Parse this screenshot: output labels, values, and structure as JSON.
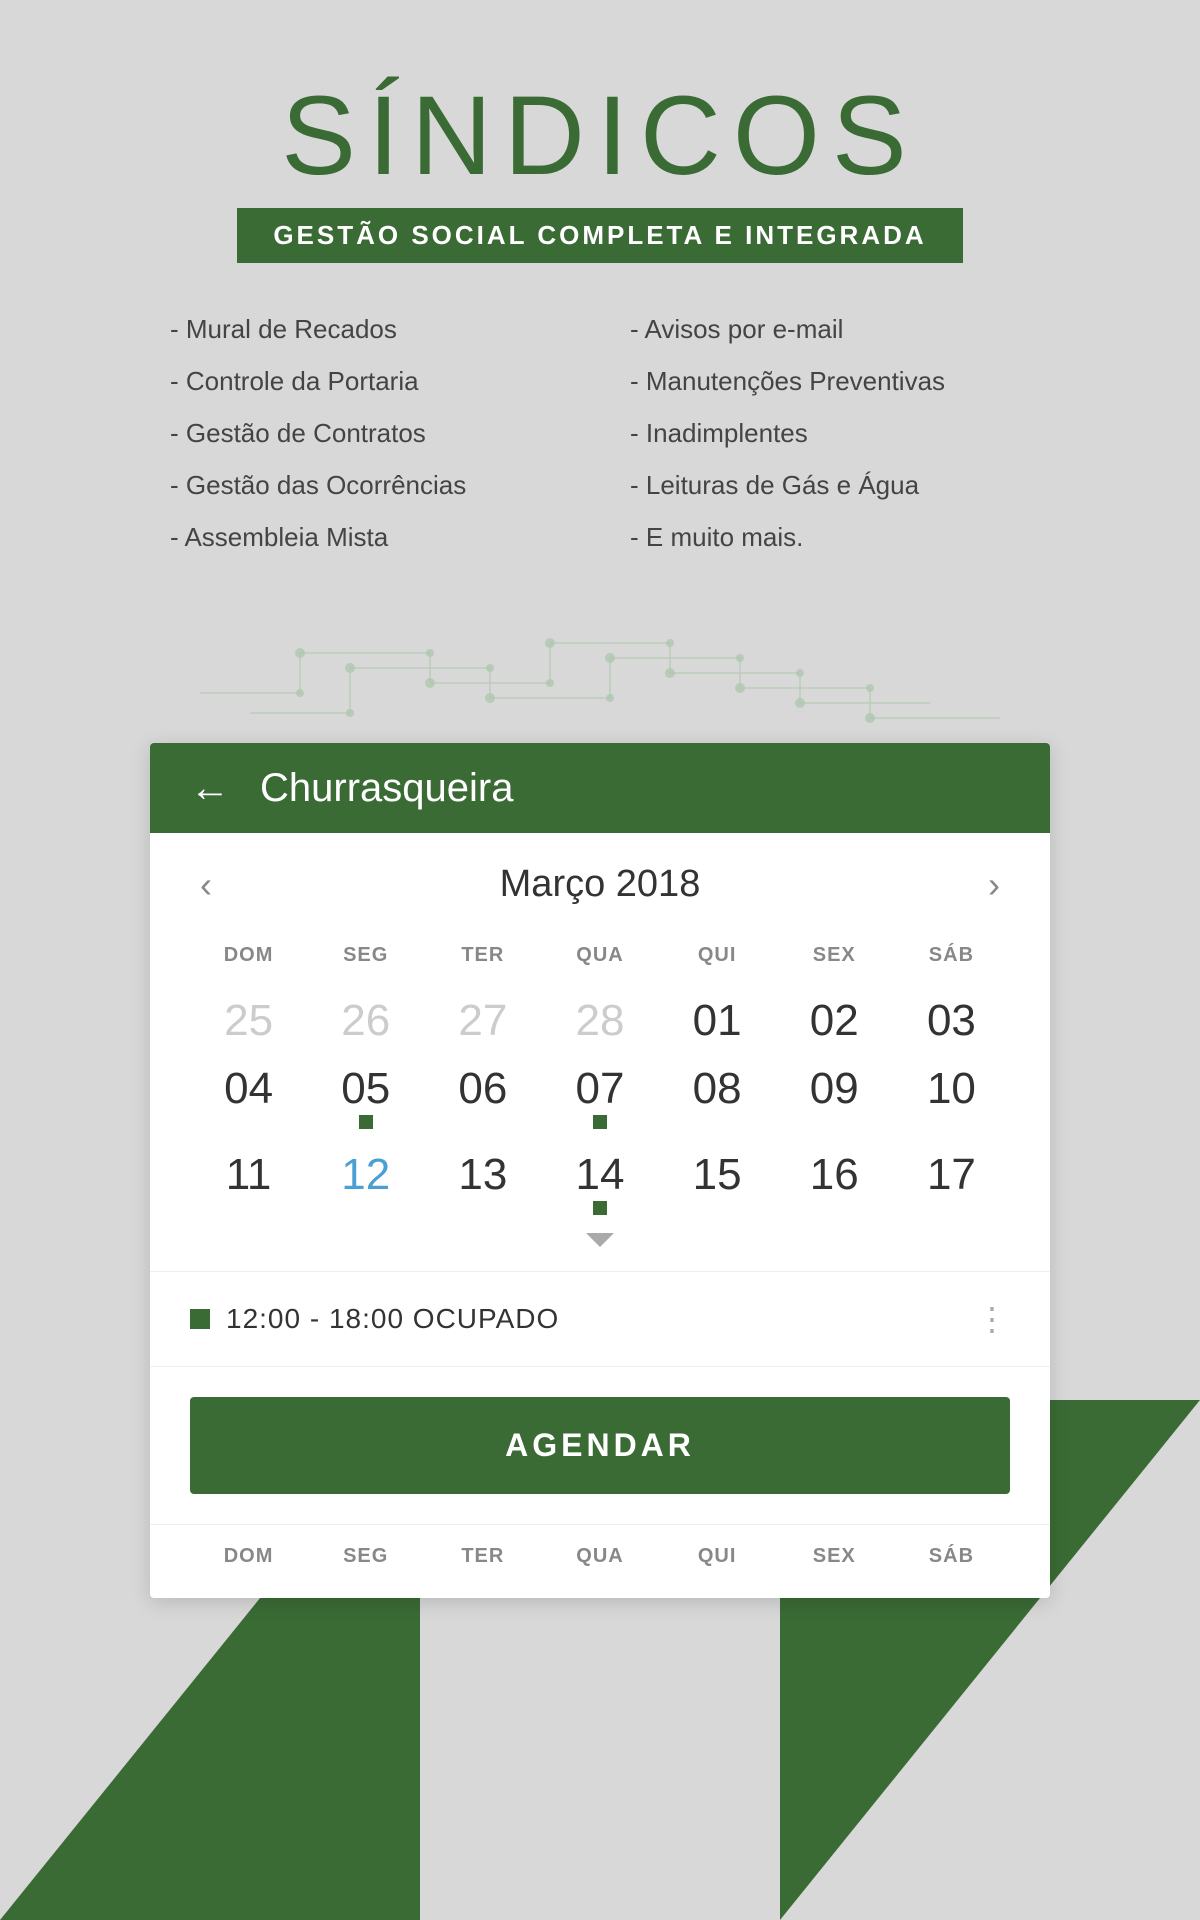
{
  "header": {
    "title": "SÍNDICOS",
    "subtitle": "GESTÃO SOCIAL COMPLETA E INTEGRADA"
  },
  "features": {
    "col1": [
      "- Mural de Recados",
      "- Controle da Portaria",
      "- Gestão de Contratos",
      "- Gestão das Ocorrências",
      "- Assembleia Mista"
    ],
    "col2": [
      "- Avisos por e-mail",
      "- Manutenções Preventivas",
      "- Inadimplentes",
      "- Leituras de Gás e Água",
      "- E muito mais."
    ]
  },
  "card": {
    "back_label": "←",
    "title": "Churrasqueira"
  },
  "calendar": {
    "month_year": "Março 2018",
    "prev_arrow": "‹",
    "next_arrow": "›",
    "day_headers": [
      "DOM",
      "SEG",
      "TER",
      "QUA",
      "QUI",
      "SEX",
      "SÁB"
    ],
    "weeks": [
      [
        {
          "num": "25",
          "inactive": true,
          "dot": false
        },
        {
          "num": "26",
          "inactive": true,
          "dot": false
        },
        {
          "num": "27",
          "inactive": true,
          "dot": false
        },
        {
          "num": "28",
          "inactive": true,
          "dot": false
        },
        {
          "num": "01",
          "inactive": false,
          "dot": false
        },
        {
          "num": "02",
          "inactive": false,
          "dot": false
        },
        {
          "num": "03",
          "inactive": false,
          "dot": false
        }
      ],
      [
        {
          "num": "04",
          "inactive": false,
          "dot": false
        },
        {
          "num": "05",
          "inactive": false,
          "dot": true
        },
        {
          "num": "06",
          "inactive": false,
          "dot": false
        },
        {
          "num": "07",
          "inactive": false,
          "dot": true
        },
        {
          "num": "08",
          "inactive": false,
          "dot": false
        },
        {
          "num": "09",
          "inactive": false,
          "dot": false
        },
        {
          "num": "10",
          "inactive": false,
          "dot": false
        }
      ],
      [
        {
          "num": "11",
          "inactive": false,
          "dot": false
        },
        {
          "num": "12",
          "inactive": false,
          "today": true,
          "dot": false
        },
        {
          "num": "13",
          "inactive": false,
          "dot": false
        },
        {
          "num": "14",
          "inactive": false,
          "dot": true
        },
        {
          "num": "15",
          "inactive": false,
          "dot": false
        },
        {
          "num": "16",
          "inactive": false,
          "dot": false
        },
        {
          "num": "17",
          "inactive": false,
          "dot": false
        }
      ]
    ]
  },
  "event": {
    "time": "12:00 - 18:00 OCUPADO",
    "menu_icon": "⋮"
  },
  "agendar_label": "AGENDAR",
  "bottom_days": [
    "DOM",
    "SEG",
    "TER",
    "QUA",
    "QUI",
    "SEX",
    "SÁB"
  ]
}
